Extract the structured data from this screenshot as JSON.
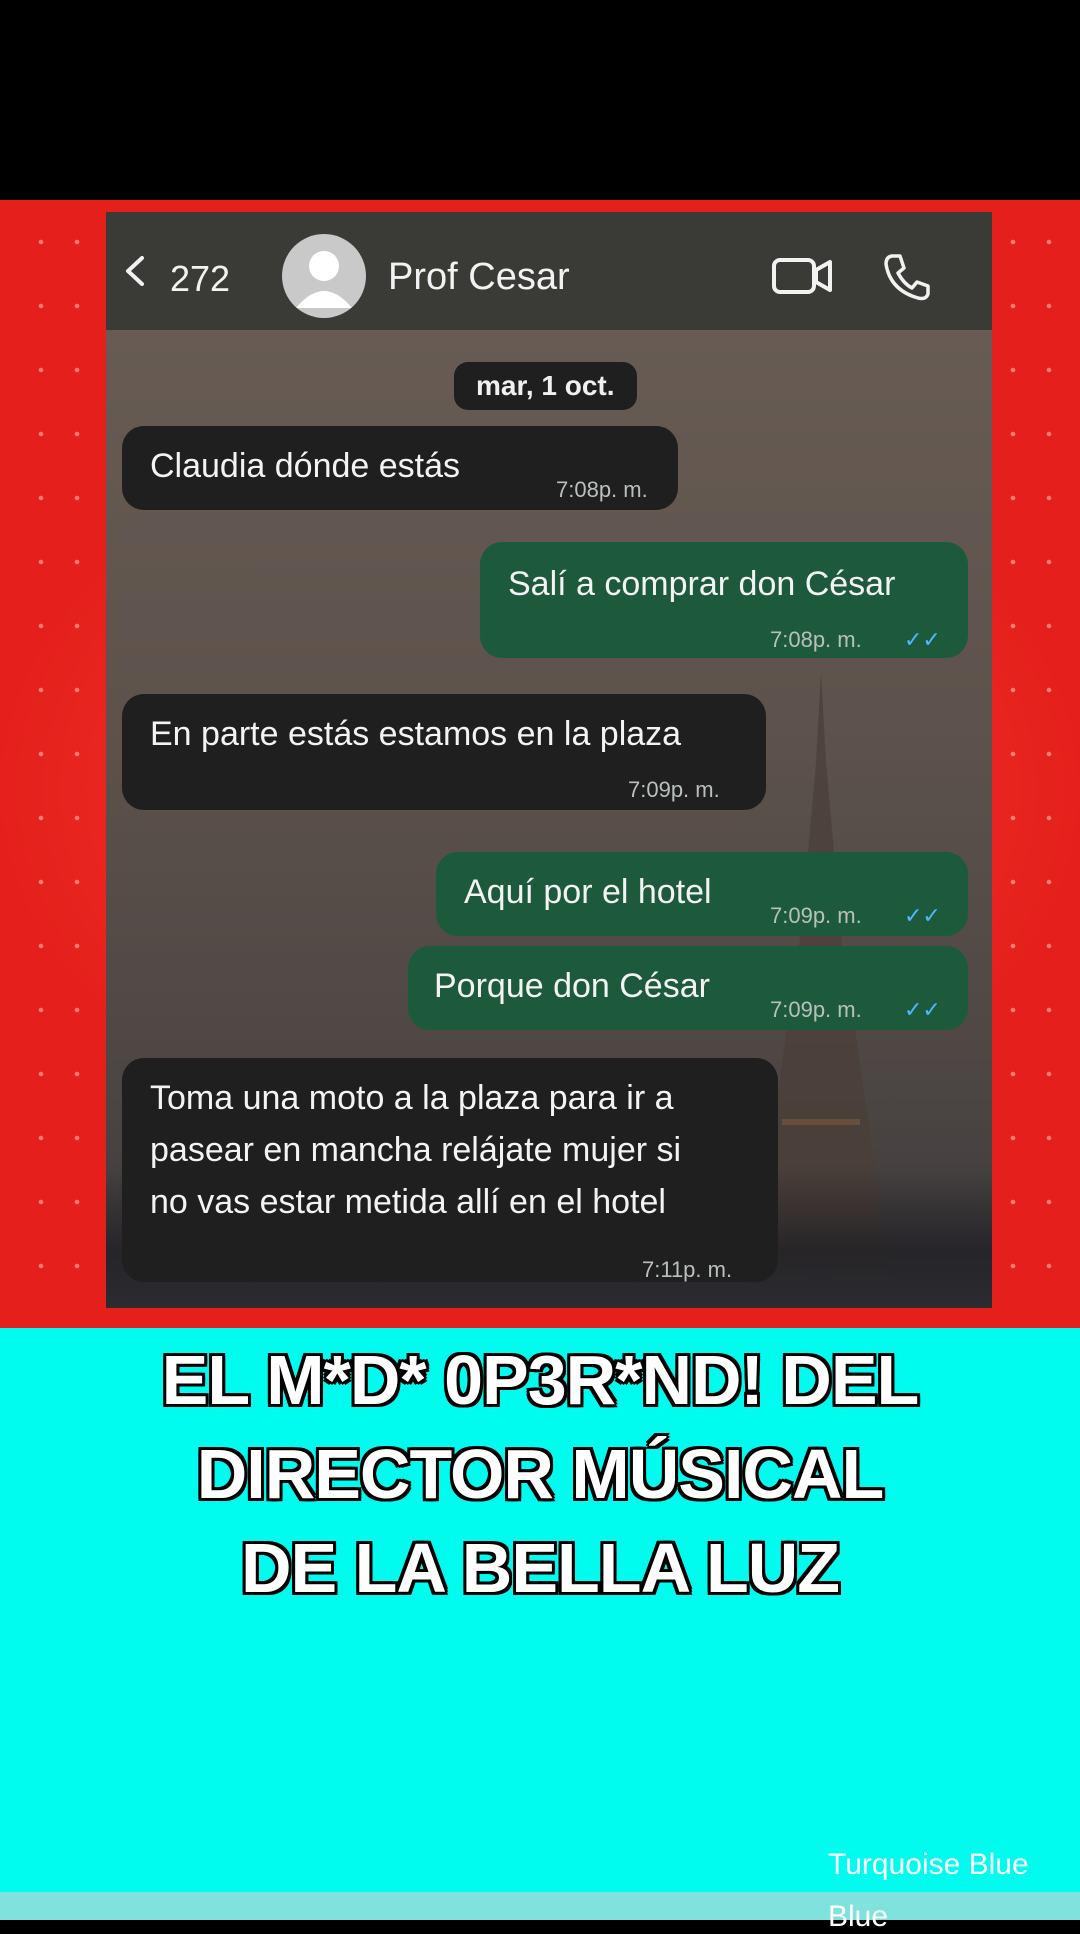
{
  "header": {
    "back_count": "272",
    "contact_name": "Prof Cesar"
  },
  "date_chip": "mar, 1 oct.",
  "messages": [
    {
      "dir": "in",
      "text": "Claudia dónde estás",
      "time": "7:08p. m."
    },
    {
      "dir": "out",
      "text": "Salí a comprar don César",
      "time": "7:08p. m."
    },
    {
      "dir": "in",
      "text": "En parte estás estamos en la plaza",
      "time": "7:09p. m."
    },
    {
      "dir": "out",
      "text": "Aquí por el hotel",
      "time": "7:09p. m."
    },
    {
      "dir": "out",
      "text": "Porque don César",
      "time": "7:09p. m."
    },
    {
      "dir": "in",
      "text_lines": [
        "Toma una moto a la plaza para ir a",
        "pasear en mancha relájate mujer si",
        "no vas estar metida allí en el hotel"
      ],
      "time": "7:11p. m."
    }
  ],
  "caption": {
    "lines": [
      "EL M*D* 0P3R*ND! DEL",
      "DIRECTOR MÚSICAL",
      "DE LA BELLA LUZ"
    ]
  },
  "watermark": "Turquoise Blue",
  "watermark_partial": "Blue",
  "icons": [
    "chevron-left-icon",
    "avatar-icon",
    "video-call-icon",
    "phone-call-icon",
    "double-check-icon"
  ],
  "colors": {
    "red_bg": "#e5201c",
    "caption_bg": "#00fbef",
    "incoming_bubble": "#1f1f1f",
    "outgoing_bubble": "#1d5a3b",
    "read_ticks": "#4fb6ff"
  }
}
